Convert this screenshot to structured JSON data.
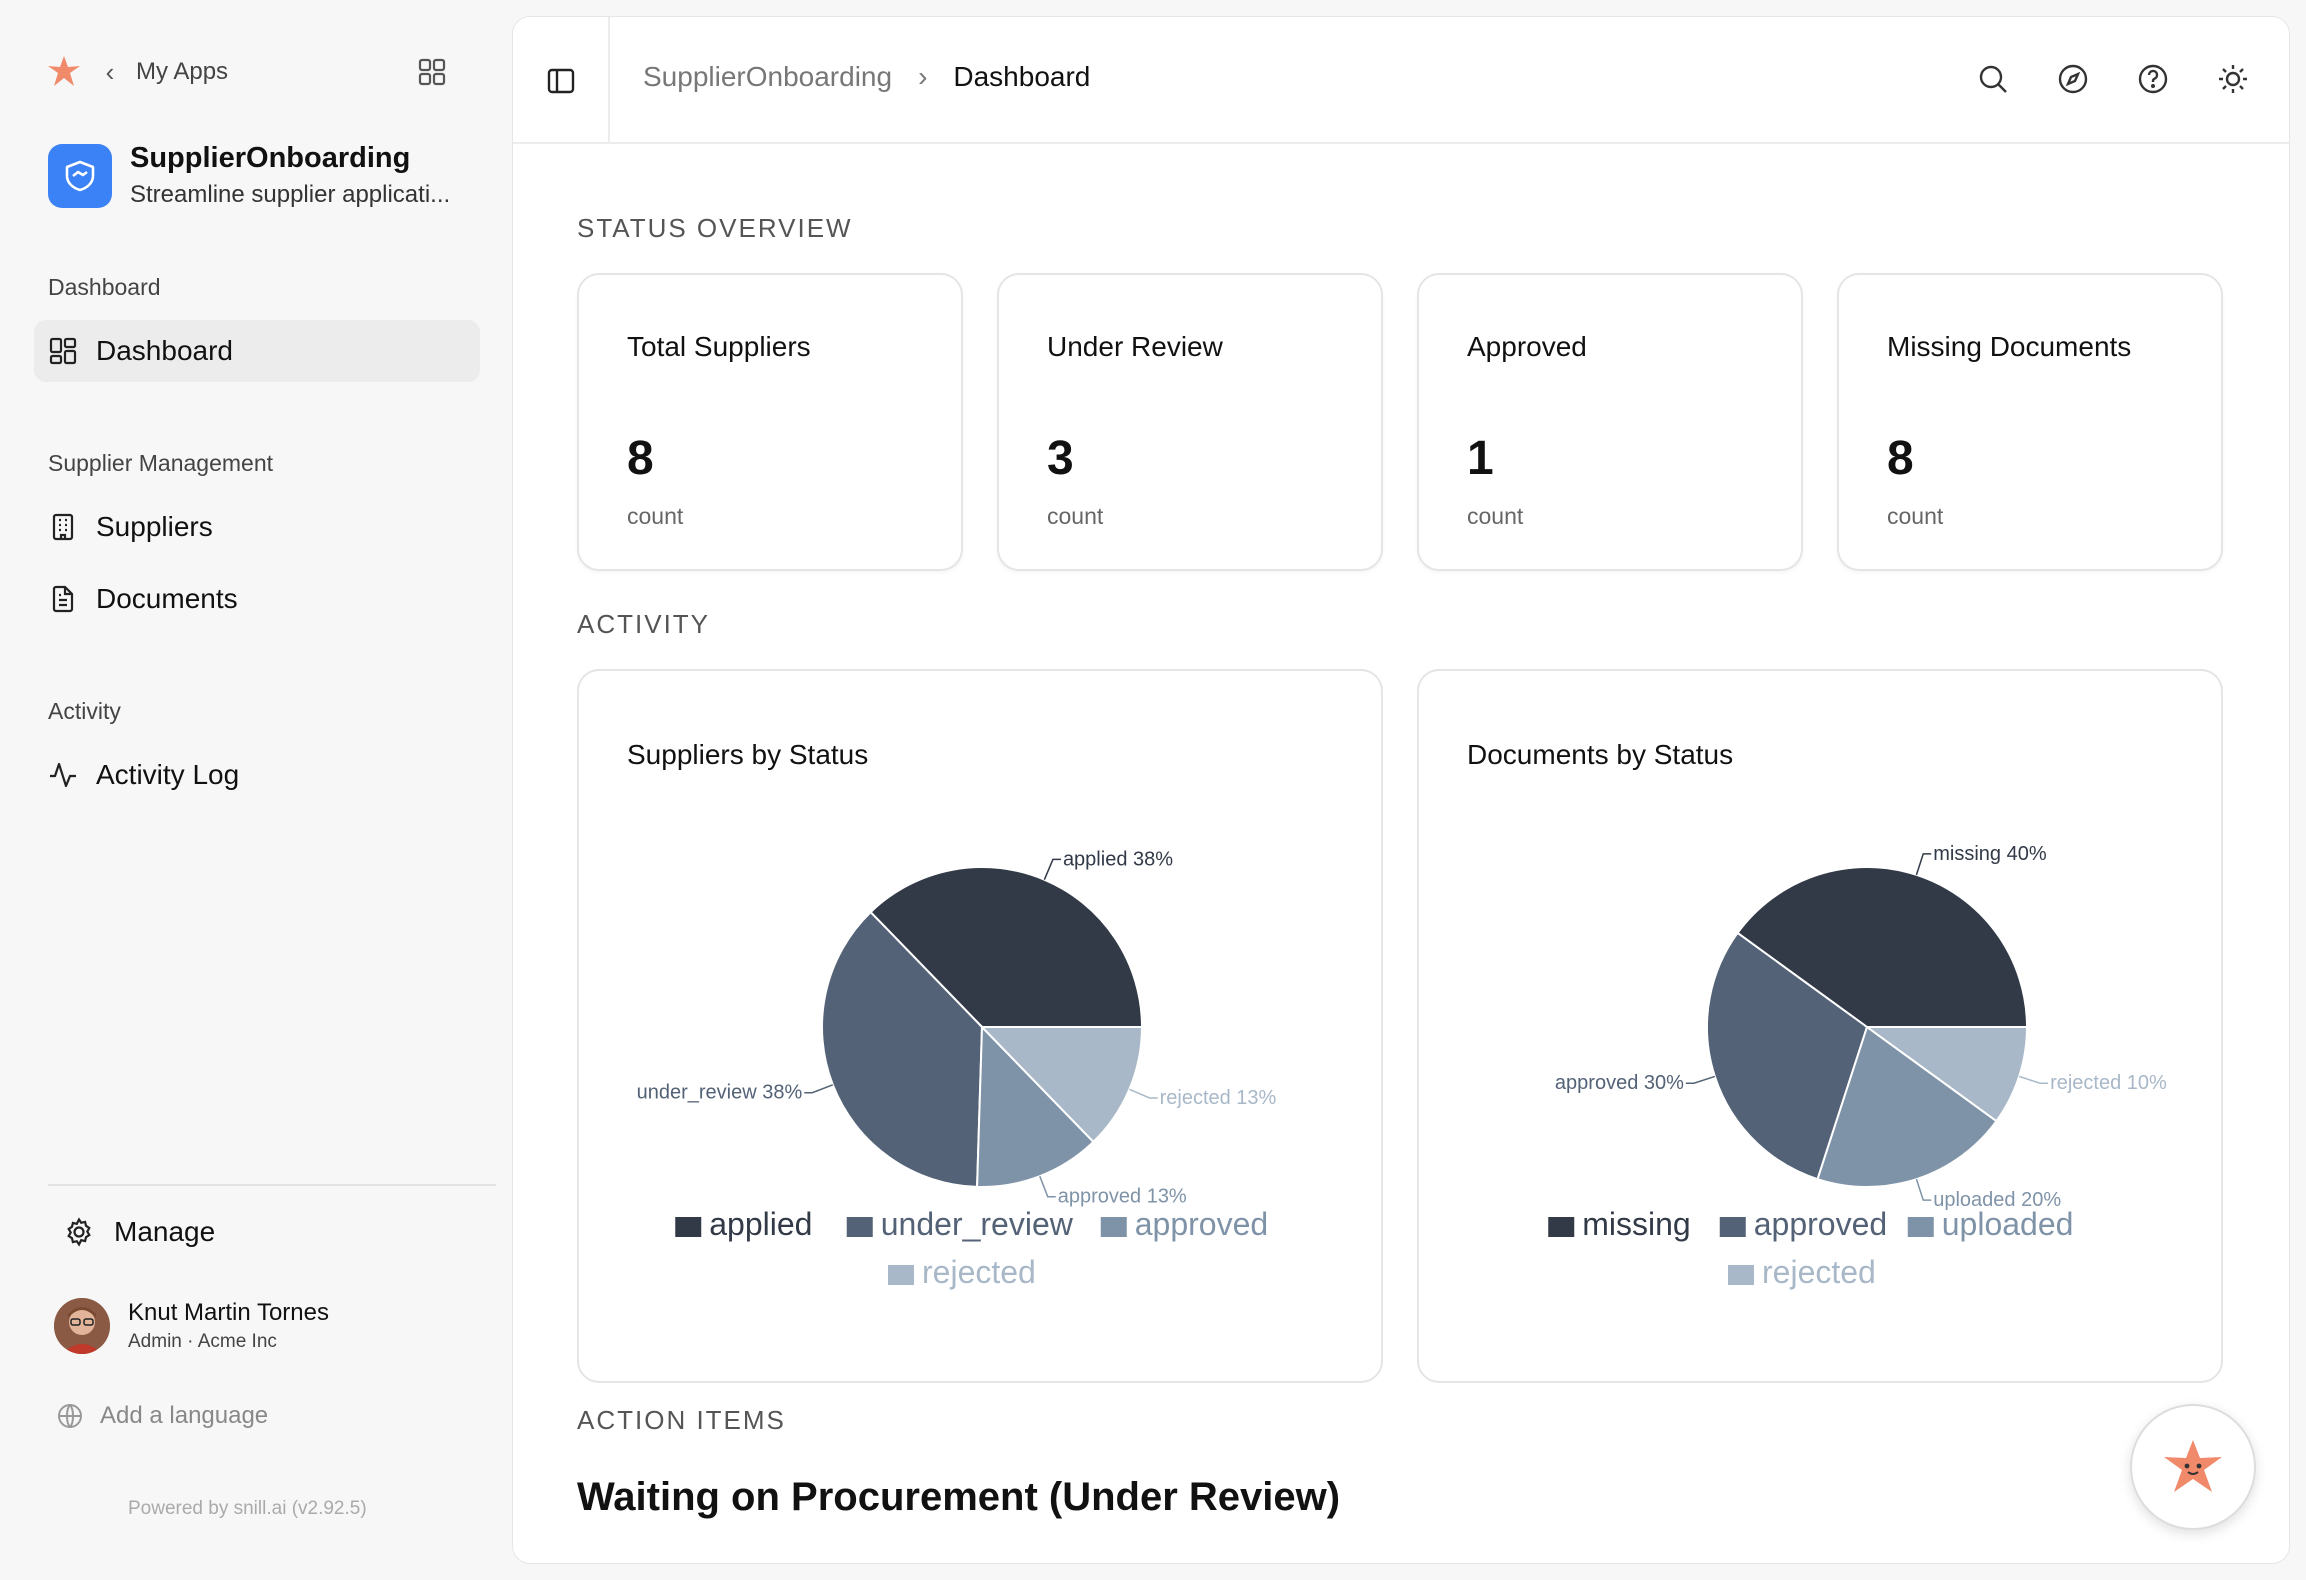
{
  "sidebar": {
    "back_label": "My Apps",
    "app": {
      "name": "SupplierOnboarding",
      "description": "Streamline supplier applicati..."
    },
    "sections": [
      {
        "label": "Dashboard",
        "items": [
          {
            "label": "Dashboard",
            "icon": "layout-dashboard-icon",
            "active": true
          }
        ]
      },
      {
        "label": "Supplier Management",
        "items": [
          {
            "label": "Suppliers",
            "icon": "building-icon"
          },
          {
            "label": "Documents",
            "icon": "file-text-icon"
          }
        ]
      },
      {
        "label": "Activity",
        "items": [
          {
            "label": "Activity Log",
            "icon": "activity-icon"
          }
        ]
      }
    ],
    "manage_label": "Manage",
    "user": {
      "name": "Knut Martin Tornes",
      "role": "Admin · Acme Inc"
    },
    "add_language": "Add a language",
    "powered_by": "Powered by snill.ai (v2.92.5)"
  },
  "header": {
    "breadcrumb": [
      "SupplierOnboarding",
      "Dashboard"
    ],
    "icons": [
      "search-icon",
      "compass-icon",
      "help-icon",
      "sun-icon"
    ]
  },
  "status_overview": {
    "heading": "STATUS OVERVIEW",
    "cards": [
      {
        "title": "Total Suppliers",
        "value": "8",
        "unit": "count"
      },
      {
        "title": "Under Review",
        "value": "3",
        "unit": "count"
      },
      {
        "title": "Approved",
        "value": "1",
        "unit": "count"
      },
      {
        "title": "Missing Documents",
        "value": "8",
        "unit": "count"
      }
    ]
  },
  "activity": {
    "heading": "ACTIVITY",
    "charts": [
      {
        "title": "Suppliers by Status"
      },
      {
        "title": "Documents by Status"
      }
    ]
  },
  "action_items": {
    "heading": "ACTION ITEMS",
    "title": "Waiting on Procurement (Under Review)"
  },
  "colors": {
    "c1": "#323a48",
    "c2": "#536276",
    "c3": "#7f93a8",
    "c4": "#a8b8c8"
  },
  "chart_data": [
    {
      "type": "pie",
      "title": "Suppliers by Status",
      "categories": [
        "applied",
        "under_review",
        "approved",
        "rejected"
      ],
      "values": [
        38,
        38,
        13,
        13
      ],
      "labels": [
        "applied 38%",
        "under_review 38%",
        "approved 13%",
        "rejected 13%"
      ],
      "legend": "bottom"
    },
    {
      "type": "pie",
      "title": "Documents by Status",
      "categories": [
        "missing",
        "approved",
        "uploaded",
        "rejected"
      ],
      "values": [
        40,
        30,
        20,
        10
      ],
      "labels": [
        "missing 40%",
        "approved 30%",
        "uploaded 20%",
        "rejected 10%"
      ],
      "legend": "bottom"
    }
  ]
}
